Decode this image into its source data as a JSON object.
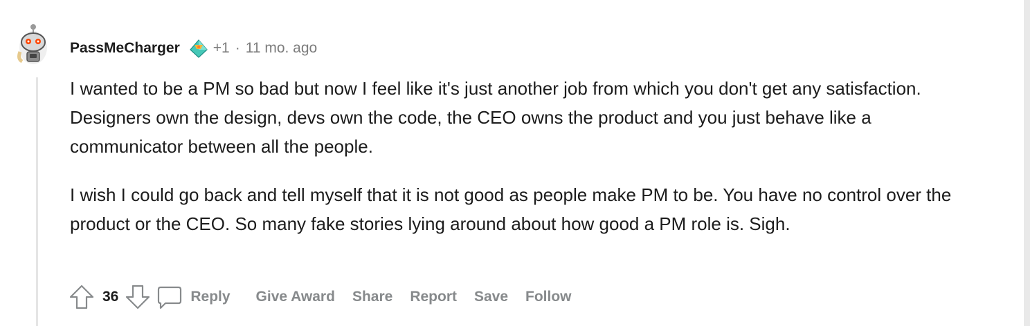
{
  "comment": {
    "author": "PassMeCharger",
    "karma_change": "+1",
    "separator": "·",
    "timestamp": "11 mo. ago",
    "paragraphs": [
      "I wanted to be a PM so bad but now I feel like it's just another job from which you don't get any satisfaction. Designers own the design, devs own the code, the CEO owns the product and you just behave like a communicator between all the people.",
      "I wish I could go back and tell myself that it is not good as people make PM to be. You have no control over the product or the CEO. So many fake stories lying around about how good a PM role is. Sigh."
    ],
    "score": "36"
  },
  "actions": {
    "reply": "Reply",
    "give_award": "Give Award",
    "share": "Share",
    "report": "Report",
    "save": "Save",
    "follow": "Follow"
  },
  "icons": {
    "avatar": "snoo-avatar-icon",
    "flair": "achievement-gem-icon",
    "upvote": "upvote-arrow-icon",
    "downvote": "downvote-arrow-icon",
    "reply": "comment-bubble-icon"
  },
  "colors": {
    "text": "#1c1c1c",
    "muted": "#7c7c7c",
    "action": "#878a8c"
  }
}
